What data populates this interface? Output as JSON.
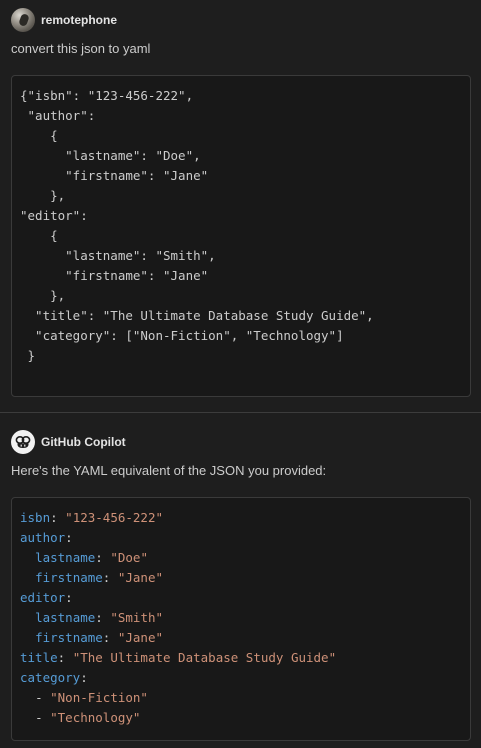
{
  "user_message": {
    "author": "remotephone",
    "text": "convert this json to yaml",
    "code_lines": [
      "{\"isbn\": \"123-456-222\",",
      " \"author\":",
      "    {",
      "      \"lastname\": \"Doe\",",
      "      \"firstname\": \"Jane\"",
      "    },",
      "\"editor\":",
      "    {",
      "      \"lastname\": \"Smith\",",
      "      \"firstname\": \"Jane\"",
      "    },",
      "  \"title\": \"The Ultimate Database Study Guide\",",
      "  \"category\": [\"Non-Fiction\", \"Technology\"]",
      " }"
    ]
  },
  "assistant_message": {
    "author": "GitHub Copilot",
    "text": "Here's the YAML equivalent of the JSON you provided:",
    "yaml": {
      "isbn_key": "isbn",
      "isbn_value": "\"123-456-222\"",
      "author_key": "author",
      "author_lastname_key": "lastname",
      "author_lastname_value": "\"Doe\"",
      "author_firstname_key": "firstname",
      "author_firstname_value": "\"Jane\"",
      "editor_key": "editor",
      "editor_lastname_key": "lastname",
      "editor_lastname_value": "\"Smith\"",
      "editor_firstname_key": "firstname",
      "editor_firstname_value": "\"Jane\"",
      "title_key": "title",
      "title_value": "\"The Ultimate Database Study Guide\"",
      "category_key": "category",
      "category_items": [
        "\"Non-Fiction\"",
        "\"Technology\""
      ]
    }
  },
  "colors": {
    "background": "#1e1e1e",
    "code_background": "#181818",
    "yaml_key": "#569cd6",
    "yaml_string": "#ce9178",
    "text": "#cccccc"
  },
  "icons": {
    "user_avatar": "user-avatar-photo",
    "copilot_avatar": "copilot-icon"
  }
}
